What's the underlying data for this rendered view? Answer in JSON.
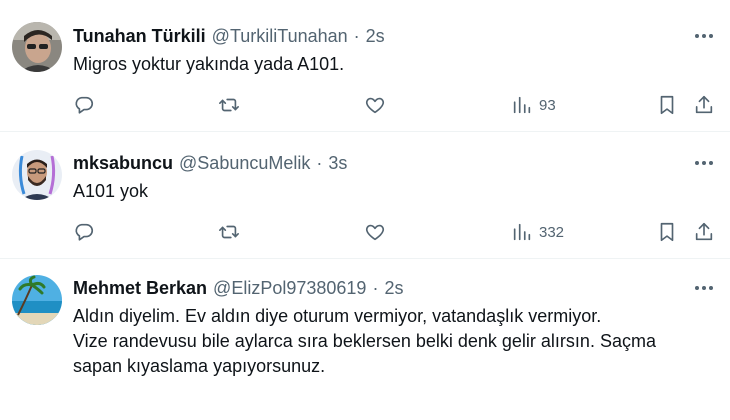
{
  "tweets": [
    {
      "name": "Tunahan Türkili",
      "handle": "@TurkiliTunahan",
      "separator": "·",
      "time": "2s",
      "text_lines": [
        "Migros yoktur yakında yada A101."
      ],
      "views": "93"
    },
    {
      "name": "mksabuncu",
      "handle": "@SabuncuMelik",
      "separator": "·",
      "time": "3s",
      "text_lines": [
        "A101 yok"
      ],
      "views": "332"
    },
    {
      "name": "Mehmet Berkan",
      "handle": "@ElizPol97380619",
      "separator": "·",
      "time": "2s",
      "text_lines": [
        "Aldın diyelim. Ev aldın diye oturum vermiyor, vatandaşlık vermiyor.",
        "Vize randevusu bile aylarca sıra beklersen belki denk gelir alırsın. Saçma",
        "sapan kıyaslama yapıyorsunuz."
      ]
    }
  ],
  "icons": {
    "reply": "reply-icon",
    "retweet": "retweet-icon",
    "like": "heart-icon",
    "views": "views-chart-icon",
    "bookmark": "bookmark-icon",
    "share": "share-icon",
    "more": "more-horizontal-icon"
  },
  "colors": {
    "secondary_text": "#536471",
    "divider": "#eff3f4"
  }
}
